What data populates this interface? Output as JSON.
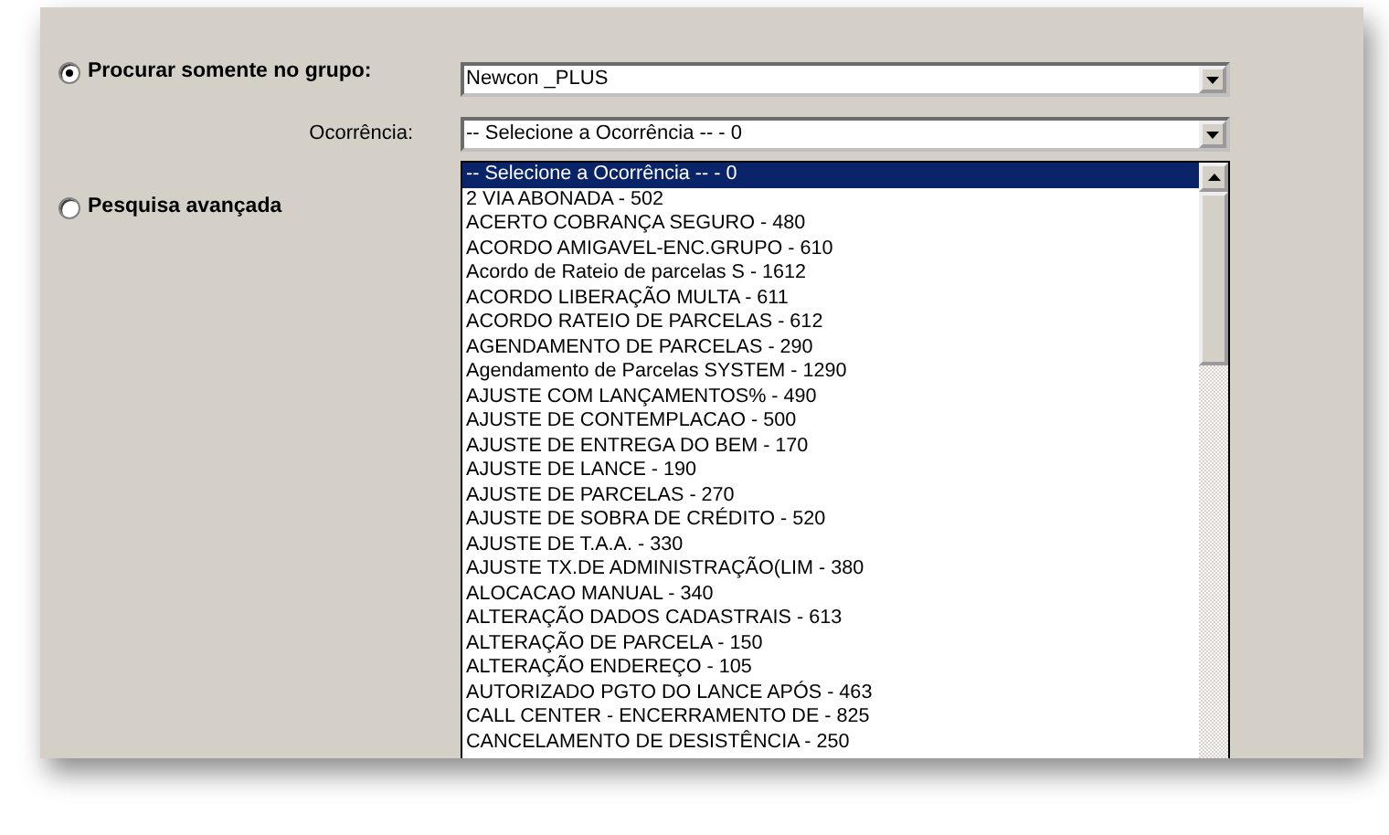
{
  "options": [
    {
      "label": "Procurar somente no grupo:",
      "selected": true
    },
    {
      "label": "Pesquisa avançada",
      "selected": false
    }
  ],
  "group_select": {
    "value": "Newcon _PLUS"
  },
  "occurrence": {
    "label": "Ocorrência:",
    "value": "-- Selecione a Ocorrência -- - 0",
    "items": [
      {
        "label": "-- Selecione a Ocorrência -- - 0",
        "selected": true
      },
      {
        "label": "2 VIA ABONADA - 502",
        "selected": false
      },
      {
        "label": "ACERTO COBRANÇA SEGURO - 480",
        "selected": false
      },
      {
        "label": "ACORDO AMIGAVEL-ENC.GRUPO - 610",
        "selected": false
      },
      {
        "label": "Acordo de Rateio de parcelas S - 1612",
        "selected": false
      },
      {
        "label": "ACORDO LIBERAÇÃO MULTA - 611",
        "selected": false
      },
      {
        "label": "ACORDO RATEIO DE PARCELAS - 612",
        "selected": false
      },
      {
        "label": "AGENDAMENTO DE PARCELAS - 290",
        "selected": false
      },
      {
        "label": "Agendamento de Parcelas SYSTEM - 1290",
        "selected": false
      },
      {
        "label": "AJUSTE COM LANÇAMENTOS% - 490",
        "selected": false
      },
      {
        "label": "AJUSTE DE CONTEMPLACAO - 500",
        "selected": false
      },
      {
        "label": "AJUSTE DE ENTREGA DO BEM - 170",
        "selected": false
      },
      {
        "label": "AJUSTE DE LANCE - 190",
        "selected": false
      },
      {
        "label": "AJUSTE DE PARCELAS - 270",
        "selected": false
      },
      {
        "label": "AJUSTE DE SOBRA DE CRÉDITO - 520",
        "selected": false
      },
      {
        "label": "AJUSTE DE T.A.A. - 330",
        "selected": false
      },
      {
        "label": "AJUSTE TX.DE ADMINISTRAÇÃO(LIM - 380",
        "selected": false
      },
      {
        "label": "ALOCACAO MANUAL - 340",
        "selected": false
      },
      {
        "label": "ALTERAÇÃO DADOS CADASTRAIS - 613",
        "selected": false
      },
      {
        "label": "ALTERAÇÃO DE PARCELA - 150",
        "selected": false
      },
      {
        "label": "ALTERAÇÃO ENDEREÇO - 105",
        "selected": false
      },
      {
        "label": "AUTORIZADO PGTO DO LANCE APÓS  - 463",
        "selected": false
      },
      {
        "label": "CALL CENTER - ENCERRAMENTO DE  - 825",
        "selected": false
      },
      {
        "label": "CANCELAMENTO DE DESISTÊNCIA - 250",
        "selected": false
      }
    ]
  }
}
